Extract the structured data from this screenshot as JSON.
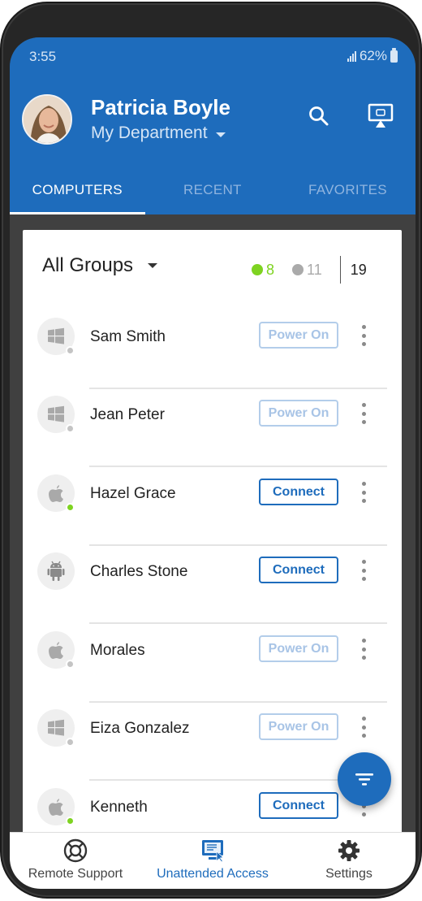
{
  "status_bar": {
    "time": "3:55",
    "battery": "62%"
  },
  "header": {
    "user_name": "Patricia Boyle",
    "department": "My Department"
  },
  "tabs": [
    {
      "label": "COMPUTERS",
      "active": true
    },
    {
      "label": "RECENT",
      "active": false
    },
    {
      "label": "FAVORITES",
      "active": false
    }
  ],
  "group_filter": {
    "label": "All Groups",
    "online_count": "8",
    "offline_count": "11",
    "total_count": "19"
  },
  "computers": [
    {
      "name": "Sam Smith",
      "os_icon": "windows-icon",
      "status": "offline",
      "action": "Power On"
    },
    {
      "name": "Jean Peter",
      "os_icon": "windows-icon",
      "status": "offline",
      "action": "Power On"
    },
    {
      "name": "Hazel Grace",
      "os_icon": "apple-icon",
      "status": "online",
      "action": "Connect"
    },
    {
      "name": "Charles Stone",
      "os_icon": "android-icon",
      "status": "none",
      "action": "Connect"
    },
    {
      "name": "Morales",
      "os_icon": "apple-icon",
      "status": "offline",
      "action": "Power On"
    },
    {
      "name": "Eiza Gonzalez",
      "os_icon": "windows-icon",
      "status": "offline",
      "action": "Power On"
    },
    {
      "name": "Kenneth",
      "os_icon": "apple-icon",
      "status": "online",
      "action": "Connect"
    }
  ],
  "bottom_nav": [
    {
      "label": "Remote Support",
      "icon": "lifebuoy-icon",
      "active": false
    },
    {
      "label": "Unattended Access",
      "icon": "monitor-icon",
      "active": true
    },
    {
      "label": "Settings",
      "icon": "gear-icon",
      "active": false
    }
  ],
  "colors": {
    "brand_blue": "#1e6cbc",
    "online_green": "#7ed321",
    "offline_gray": "#aaaaaa"
  }
}
